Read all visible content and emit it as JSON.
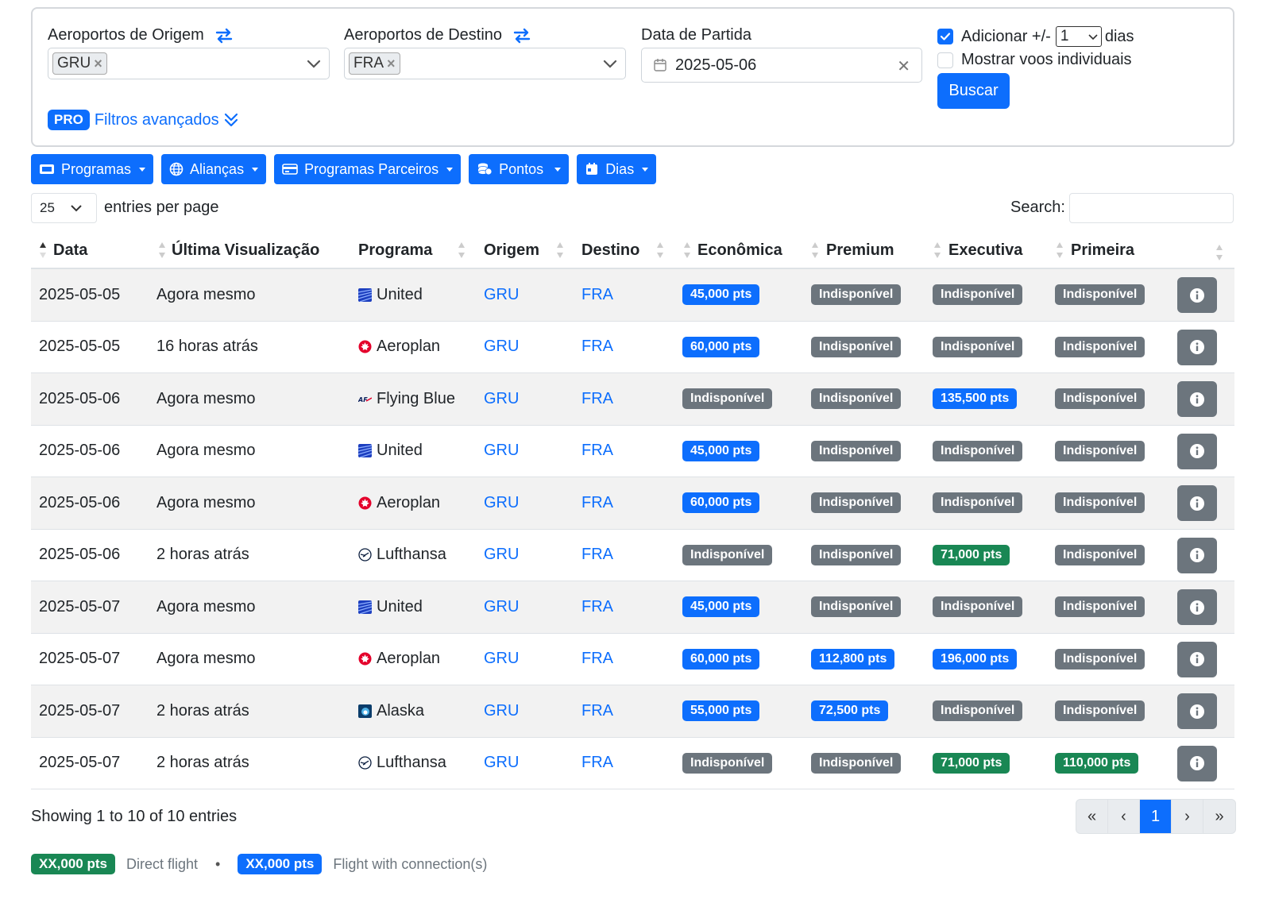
{
  "search": {
    "origin_label": "Aeroportos de Origem",
    "origin_tag": "GRU",
    "dest_label": "Aeroportos de Destino",
    "dest_tag": "FRA",
    "date_label": "Data de Partida",
    "date_value": "2025-05-06",
    "add_days_label": "Adicionar +/-",
    "add_days_value": "1",
    "days_suffix": "dias",
    "individual_label": "Mostrar voos individuais",
    "search_button": "Buscar",
    "pro_badge": "PRO",
    "advanced_filters": "Filtros avançados"
  },
  "filters": [
    "Programas",
    "Alianças",
    "Programas Parceiros",
    "Pontos",
    "Dias"
  ],
  "table_controls": {
    "page_length": "25",
    "entries_label": "entries per page",
    "search_label": "Search:"
  },
  "columns": [
    "Data",
    "Última Visualização",
    "Programa",
    "Origem",
    "Destino",
    "Econômica",
    "Premium",
    "Executiva",
    "Primeira"
  ],
  "rows": [
    {
      "date": "2025-05-05",
      "seen": "Agora mesmo",
      "program": "United",
      "icon": "united",
      "origin": "GRU",
      "dest": "FRA",
      "economy": {
        "text": "45,000 pts",
        "color": "blue"
      },
      "premium": {
        "text": "Indisponível",
        "color": "gray"
      },
      "business": {
        "text": "Indisponível",
        "color": "gray"
      },
      "first": {
        "text": "Indisponível",
        "color": "gray"
      }
    },
    {
      "date": "2025-05-05",
      "seen": "16 horas atrás",
      "program": "Aeroplan",
      "icon": "aeroplan",
      "origin": "GRU",
      "dest": "FRA",
      "economy": {
        "text": "60,000 pts",
        "color": "blue"
      },
      "premium": {
        "text": "Indisponível",
        "color": "gray"
      },
      "business": {
        "text": "Indisponível",
        "color": "gray"
      },
      "first": {
        "text": "Indisponível",
        "color": "gray"
      }
    },
    {
      "date": "2025-05-06",
      "seen": "Agora mesmo",
      "program": "Flying Blue",
      "icon": "flyingblue",
      "origin": "GRU",
      "dest": "FRA",
      "economy": {
        "text": "Indisponível",
        "color": "gray"
      },
      "premium": {
        "text": "Indisponível",
        "color": "gray"
      },
      "business": {
        "text": "135,500 pts",
        "color": "blue"
      },
      "first": {
        "text": "Indisponível",
        "color": "gray"
      }
    },
    {
      "date": "2025-05-06",
      "seen": "Agora mesmo",
      "program": "United",
      "icon": "united",
      "origin": "GRU",
      "dest": "FRA",
      "economy": {
        "text": "45,000 pts",
        "color": "blue"
      },
      "premium": {
        "text": "Indisponível",
        "color": "gray"
      },
      "business": {
        "text": "Indisponível",
        "color": "gray"
      },
      "first": {
        "text": "Indisponível",
        "color": "gray"
      }
    },
    {
      "date": "2025-05-06",
      "seen": "Agora mesmo",
      "program": "Aeroplan",
      "icon": "aeroplan",
      "origin": "GRU",
      "dest": "FRA",
      "economy": {
        "text": "60,000 pts",
        "color": "blue"
      },
      "premium": {
        "text": "Indisponível",
        "color": "gray"
      },
      "business": {
        "text": "Indisponível",
        "color": "gray"
      },
      "first": {
        "text": "Indisponível",
        "color": "gray"
      }
    },
    {
      "date": "2025-05-06",
      "seen": "2 horas atrás",
      "program": "Lufthansa",
      "icon": "lufthansa",
      "origin": "GRU",
      "dest": "FRA",
      "economy": {
        "text": "Indisponível",
        "color": "gray"
      },
      "premium": {
        "text": "Indisponível",
        "color": "gray"
      },
      "business": {
        "text": "71,000 pts",
        "color": "green"
      },
      "first": {
        "text": "Indisponível",
        "color": "gray"
      }
    },
    {
      "date": "2025-05-07",
      "seen": "Agora mesmo",
      "program": "United",
      "icon": "united",
      "origin": "GRU",
      "dest": "FRA",
      "economy": {
        "text": "45,000 pts",
        "color": "blue"
      },
      "premium": {
        "text": "Indisponível",
        "color": "gray"
      },
      "business": {
        "text": "Indisponível",
        "color": "gray"
      },
      "first": {
        "text": "Indisponível",
        "color": "gray"
      }
    },
    {
      "date": "2025-05-07",
      "seen": "Agora mesmo",
      "program": "Aeroplan",
      "icon": "aeroplan",
      "origin": "GRU",
      "dest": "FRA",
      "economy": {
        "text": "60,000 pts",
        "color": "blue"
      },
      "premium": {
        "text": "112,800 pts",
        "color": "blue"
      },
      "business": {
        "text": "196,000 pts",
        "color": "blue"
      },
      "first": {
        "text": "Indisponível",
        "color": "gray"
      }
    },
    {
      "date": "2025-05-07",
      "seen": "2 horas atrás",
      "program": "Alaska",
      "icon": "alaska",
      "origin": "GRU",
      "dest": "FRA",
      "economy": {
        "text": "55,000 pts",
        "color": "blue"
      },
      "premium": {
        "text": "72,500 pts",
        "color": "blue"
      },
      "business": {
        "text": "Indisponível",
        "color": "gray"
      },
      "first": {
        "text": "Indisponível",
        "color": "gray"
      }
    },
    {
      "date": "2025-05-07",
      "seen": "2 horas atrás",
      "program": "Lufthansa",
      "icon": "lufthansa",
      "origin": "GRU",
      "dest": "FRA",
      "economy": {
        "text": "Indisponível",
        "color": "gray"
      },
      "premium": {
        "text": "Indisponível",
        "color": "gray"
      },
      "business": {
        "text": "71,000 pts",
        "color": "green"
      },
      "first": {
        "text": "110,000 pts",
        "color": "green"
      }
    }
  ],
  "footer": {
    "showing": "Showing 1 to 10 of 10 entries",
    "pages": [
      "«",
      "‹",
      "1",
      "›",
      "»"
    ],
    "active_page": "1"
  },
  "legend": {
    "direct_badge": "XX,000 pts",
    "direct_label": "Direct flight",
    "separator": "•",
    "connection_badge": "XX,000 pts",
    "connection_label": "Flight with connection(s)"
  },
  "colors": {
    "blue": "#0d6efd",
    "gray": "#6c757d",
    "green": "#198754"
  }
}
